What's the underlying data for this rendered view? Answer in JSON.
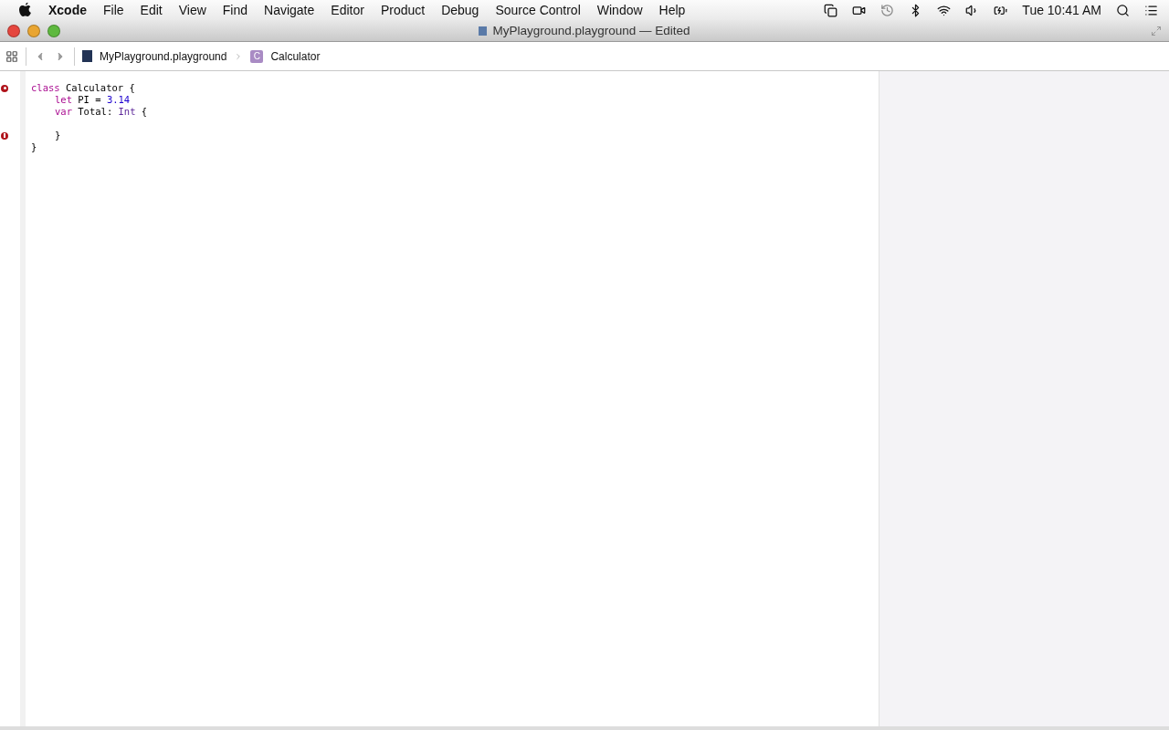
{
  "menu_bar": {
    "items": [
      {
        "label": "Xcode",
        "kind": "app"
      },
      {
        "label": "File",
        "kind": "menu"
      },
      {
        "label": "Edit",
        "kind": "menu"
      },
      {
        "label": "View",
        "kind": "menu"
      },
      {
        "label": "Find",
        "kind": "menu"
      },
      {
        "label": "Navigate",
        "kind": "menu"
      },
      {
        "label": "Editor",
        "kind": "menu"
      },
      {
        "label": "Product",
        "kind": "menu"
      },
      {
        "label": "Debug",
        "kind": "menu"
      },
      {
        "label": "Source Control",
        "kind": "menu"
      },
      {
        "label": "Window",
        "kind": "menu"
      },
      {
        "label": "Help",
        "kind": "menu"
      }
    ],
    "clock": "Tue 10:41 AM"
  },
  "window": {
    "title": "MyPlayground.playground — Edited"
  },
  "jump_bar": {
    "file": "MyPlayground.playground",
    "symbol_badge": "C",
    "symbol": "Calculator"
  },
  "editor": {
    "lines": [
      {
        "kind": "code",
        "marker": {
          "kind": "stop"
        },
        "tokens": [
          {
            "text": "class",
            "kind": "keyword"
          },
          {
            "text": " Calculator {",
            "kind": "plain"
          }
        ],
        "children": [
          {
            "kind": "code",
            "tokens": [
              {
                "text": "let",
                "kind": "keyword"
              },
              {
                "text": " PI = ",
                "kind": "plain"
              },
              {
                "text": "3.14",
                "kind": "number"
              }
            ]
          },
          {
            "kind": "code",
            "tokens": [
              {
                "text": "var",
                "kind": "keyword"
              },
              {
                "text": " Total: ",
                "kind": "plain"
              },
              {
                "text": "Int",
                "kind": "type"
              },
              {
                "text": " {",
                "kind": "plain"
              }
            ]
          },
          {
            "kind": "blank"
          },
          {
            "kind": "code",
            "marker": {
              "kind": "error"
            },
            "tokens": [
              {
                "text": "}",
                "kind": "plain"
              }
            ]
          }
        ]
      },
      {
        "kind": "code",
        "tokens": [
          {
            "text": "}",
            "kind": "plain"
          }
        ]
      }
    ]
  }
}
